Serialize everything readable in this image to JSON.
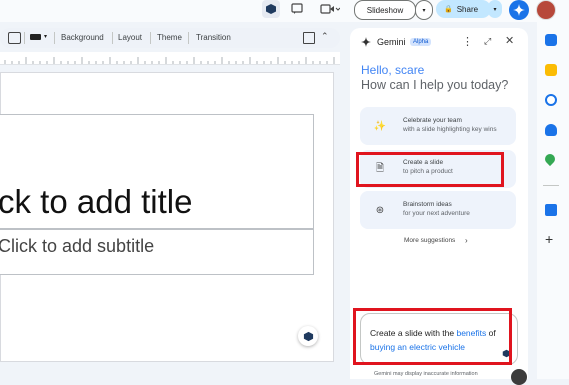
{
  "toolbar": {
    "background": "Background",
    "layout": "Layout",
    "theme": "Theme",
    "transition": "Transition"
  },
  "header": {
    "slideshow": "Slideshow",
    "share": "Share"
  },
  "slide": {
    "title_placeholder": "ck to add title",
    "subtitle_placeholder": "Click to add subtitle"
  },
  "gemini": {
    "name": "Gemini",
    "badge": "Alpha",
    "greeting": "Hello, scare",
    "prompt": "How can I help you today?",
    "suggestions": [
      {
        "title": "Celebrate your team",
        "subtitle": "with a slide highlighting key wins"
      },
      {
        "title": "Create a slide",
        "subtitle": "to pitch a product"
      },
      {
        "title": "Brainstorm ideas",
        "subtitle": "for your next adventure"
      }
    ],
    "more": "More suggestions",
    "input": {
      "part1": "Create a slide with the ",
      "link1": "benefits",
      "part2": " of",
      "link2": "buying an electric vehicle"
    },
    "disclaimer": "Gemini may display inaccurate information"
  },
  "colors": {
    "accent": "#1a73e8",
    "highlight_box": "#e0141e",
    "greeting_blue": "#4285f4"
  }
}
